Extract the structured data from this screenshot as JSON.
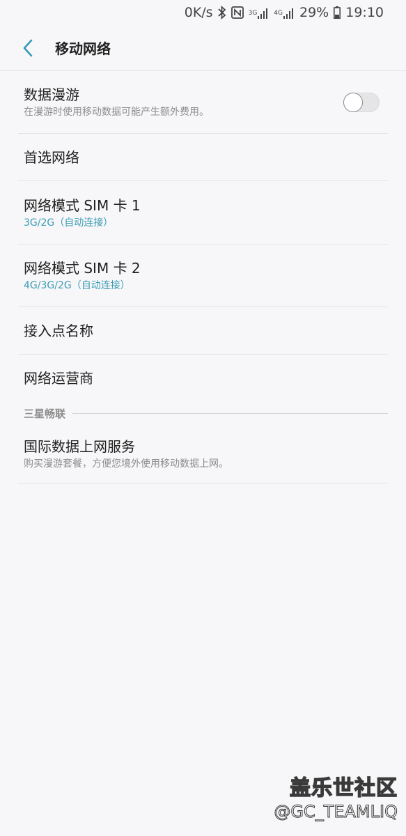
{
  "status_bar": {
    "speed": "0K/s",
    "bluetooth_icon": "bluetooth-icon",
    "nfc_icon": "nfc-icon",
    "sim1_net": "3G",
    "sim2_net": "4G",
    "battery_percent": "29%",
    "time": "19:10"
  },
  "app_bar": {
    "back_icon": "chevron-left-icon",
    "title": "移动网络"
  },
  "settings": {
    "roaming": {
      "title": "数据漫游",
      "subtitle": "在漫游时使用移动数据可能产生额外费用。",
      "toggle_on": false
    },
    "preferred_network": {
      "title": "首选网络"
    },
    "sim1_mode": {
      "title": "网络模式 SIM 卡 1",
      "value": "3G/2G（自动连接）"
    },
    "sim2_mode": {
      "title": "网络模式 SIM 卡 2",
      "value": "4G/3G/2G（自动连接）"
    },
    "apn": {
      "title": "接入点名称"
    },
    "operator": {
      "title": "网络运营商"
    },
    "section_samsung": {
      "label": "三星畅联"
    },
    "intl_data": {
      "title": "国际数据上网服务",
      "subtitle": "购买漫游套餐，方便您境外使用移动数据上网。"
    }
  },
  "watermark": {
    "main": "盖乐世社区",
    "sub": "@GC_TEAMLIQ"
  },
  "colors": {
    "background": "#f7f7f9",
    "accent": "#3a9bb4",
    "divider": "#e4e4e6"
  }
}
